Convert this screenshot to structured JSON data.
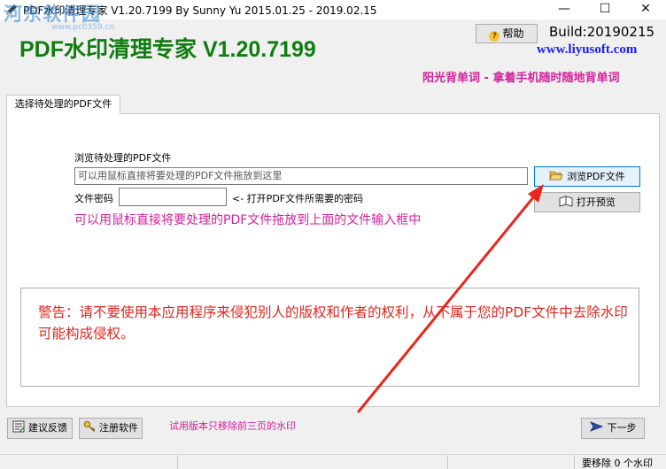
{
  "window": {
    "title": "PDF水印清理专家 V1.20.7199 By Sunny Yu 2015.01.25 - 2019.02.15",
    "watermark": "河东软件园",
    "watermark_sub": "www.pc0359.cn",
    "minimize_glyph": "—",
    "maximize_glyph": "☐",
    "close_glyph": "✕"
  },
  "header": {
    "app_title": "PDF水印清理专家 V1.20.7199",
    "help_label": "帮助",
    "help_icon_glyph": "?",
    "build": "Build:20190215",
    "website": "www.liyusoft.com",
    "promo": "阳光背单词 - 拿着手机随时随地背单词"
  },
  "tabs": [
    {
      "label": "选择待处理的PDF文件",
      "active": true
    }
  ],
  "form": {
    "browse_label": "浏览待处理的PDF文件",
    "path_placeholder": "可以用鼠标直接将要处理的PDF文件拖放到这里",
    "browse_button": "浏览PDF文件",
    "password_label": "文件密码",
    "password_value": "",
    "password_hint": "<- 打开PDF文件所需要的密码",
    "preview_button": "打开预览",
    "drag_hint": "可以用鼠标直接将要处理的PDF文件拖放到上面的文件输入框中"
  },
  "warning": {
    "text": "警告：请不要使用本应用程序来侵犯别人的版权和作者的权利，从不属于您的PDF文件中去除水印可能构成侵权。"
  },
  "footer": {
    "feedback_button": "建议反馈",
    "register_button": "注册软件",
    "trial_notice": "试用版本只移除前三页的水印",
    "next_button": "下一步"
  },
  "statusbar": {
    "removed_count": "要移除 0 个水印"
  },
  "colors": {
    "app_title": "#0f7d0f",
    "link": "#1a1aff",
    "promo": "#d4209a",
    "warning": "#e0261f",
    "annotation_arrow": "#e8261d"
  },
  "icons": {
    "app": "app-pen-icon",
    "folder": "folder-open-icon",
    "book": "book-icon",
    "feedback": "feedback-icon",
    "key": "key-icon",
    "next": "next-arrow-icon"
  }
}
